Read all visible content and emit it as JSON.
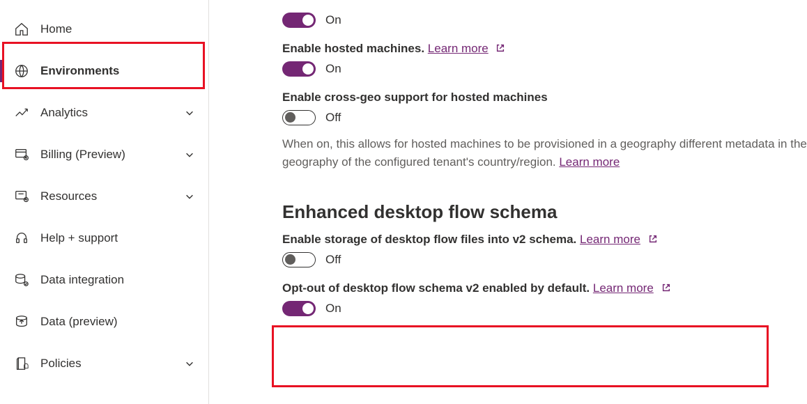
{
  "sidebar": {
    "items": [
      {
        "label": "Home"
      },
      {
        "label": "Environments"
      },
      {
        "label": "Analytics"
      },
      {
        "label": "Billing (Preview)"
      },
      {
        "label": "Resources"
      },
      {
        "label": "Help + support"
      },
      {
        "label": "Data integration"
      },
      {
        "label": "Data (preview)"
      },
      {
        "label": "Policies"
      }
    ]
  },
  "settings": {
    "s0": {
      "state": "On"
    },
    "s1": {
      "title": "Enable hosted machines.",
      "learn": "Learn more",
      "state": "On"
    },
    "s2": {
      "title": "Enable cross-geo support for hosted machines",
      "state": "Off",
      "descA": "When on, this allows for hosted machines to be provisioned in a geography different metadata in the geography of the configured tenant's country/region. ",
      "descLink": "Learn more"
    },
    "section2": "Enhanced desktop flow schema",
    "s3": {
      "title": "Enable storage of desktop flow files into v2 schema.",
      "learn": "Learn more",
      "state": "Off"
    },
    "s4": {
      "title": "Opt-out of desktop flow schema v2 enabled by default.",
      "learn": "Learn more",
      "state": "On"
    }
  }
}
